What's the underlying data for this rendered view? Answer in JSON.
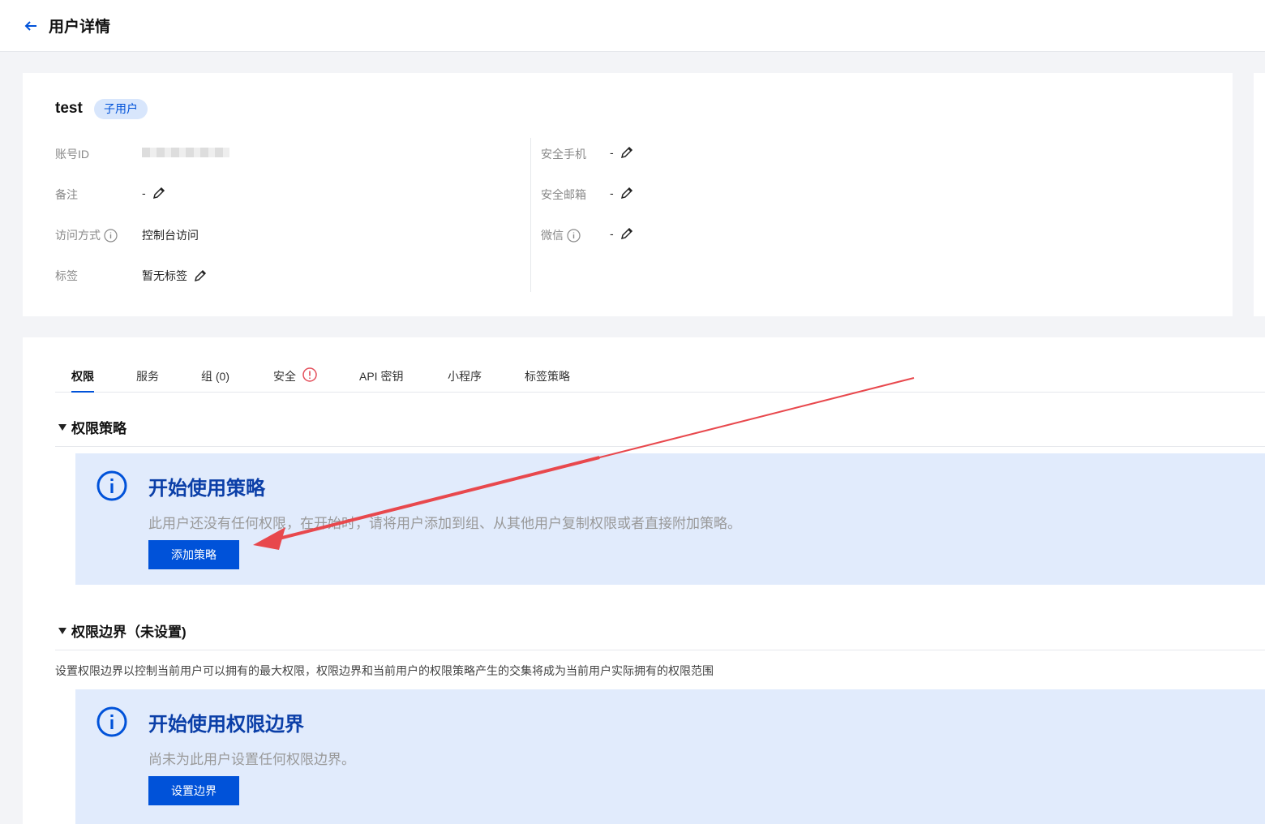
{
  "header": {
    "title": "用户详情"
  },
  "user": {
    "name": "test",
    "badge": "子用户",
    "left_fields": [
      {
        "label": "账号ID",
        "value": ""
      },
      {
        "label": "备注",
        "value": "-"
      },
      {
        "label": "访问方式",
        "value": "控制台访问"
      },
      {
        "label": "标签",
        "value": "暂无标签"
      }
    ],
    "right_fields": [
      {
        "label": "安全手机",
        "value": "-"
      },
      {
        "label": "安全邮箱",
        "value": "-"
      },
      {
        "label": "微信",
        "value": "-"
      }
    ]
  },
  "tabs": [
    {
      "label": "权限"
    },
    {
      "label": "服务"
    },
    {
      "label": "组 (0)"
    },
    {
      "label": "安全"
    },
    {
      "label": "API 密钥"
    },
    {
      "label": "小程序"
    },
    {
      "label": "标签策略"
    }
  ],
  "policies": {
    "section_title": "权限策略",
    "alert_title": "开始使用策略",
    "alert_text": "此用户还没有任何权限，在开始时，请将用户添加到组、从其他用户复制权限或者直接附加策略。",
    "button_label": "添加策略"
  },
  "boundary": {
    "section_title": "权限边界（未设置)",
    "description": "设置权限边界以控制当前用户可以拥有的最大权限，权限边界和当前用户的权限策略产生的交集将成为当前用户实际拥有的权限范围",
    "alert_title": "开始使用权限边界",
    "alert_text": "尚未为此用户设置任何权限边界。",
    "button_label": "设置边界"
  },
  "colors": {
    "primary": "#0052d9",
    "alert_bg": "#e1ebfc",
    "annotation_arrow": "#e8484d",
    "warning": "#e34d59"
  },
  "icons": [
    "back-arrow-icon",
    "pencil-icon",
    "info-circle-icon",
    "warning-circle-icon",
    "caret-down-icon"
  ]
}
